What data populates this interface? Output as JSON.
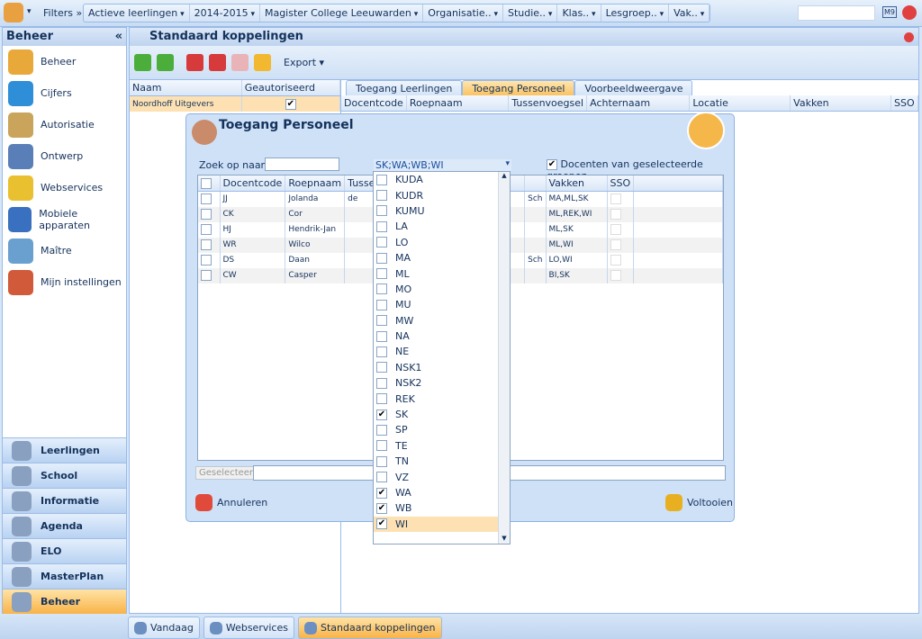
{
  "topbar": {
    "filters_label": "Filters »",
    "filters": [
      "Actieve leerlingen",
      "2014-2015",
      "Magister College Leeuwarden",
      "Organisatie..",
      "Studie..",
      "Klas..",
      "Lesgroep..",
      "Vak.."
    ],
    "search_placeholder": "",
    "m9": "M9"
  },
  "sidebar": {
    "title": "Beheer",
    "collapse": "«",
    "items": [
      "Beheer",
      "Cijfers",
      "Autorisatie",
      "Ontwerp",
      "Webservices",
      "Mobiele apparaten",
      "Maître",
      "Mijn instellingen"
    ],
    "nav": [
      "Leerlingen",
      "School",
      "Informatie",
      "Agenda",
      "ELO",
      "MasterPlan",
      "Beheer"
    ],
    "nav_active": "Beheer"
  },
  "main": {
    "title": "Standaard koppelingen",
    "export_label": "Export",
    "left_table": {
      "headers": [
        "Naam",
        "Geautoriseerd"
      ],
      "rows": [
        {
          "naam": "Noordhoff Uitgevers",
          "geautoriseerd": true
        }
      ]
    },
    "tabs": [
      "Toegang Leerlingen",
      "Toegang Personeel",
      "Voorbeeldweergave"
    ],
    "active_tab": "Toegang Personeel",
    "right_headers": [
      "Docentcode",
      "Roepnaam",
      "Tussenvoegsel",
      "Achternaam",
      "Locatie",
      "Vakken",
      "SSO"
    ]
  },
  "dialog": {
    "title": "Toegang Personeel",
    "search_label": "Zoek op naam",
    "search_value": "",
    "vak_select": "SK;WA;WB;WI",
    "groups_checkbox_label": "Docenten van geselecteerde groepen",
    "groups_checked": true,
    "headers": [
      "Docentcode",
      "Roepnaam",
      "Tussenvo",
      "Vakken",
      "SSO"
    ],
    "rows": [
      {
        "code": "JJ",
        "roepnaam": "Jolanda",
        "tussen": "de",
        "locatie": "Sch",
        "vakken": "MA,ML,SK"
      },
      {
        "code": "CK",
        "roepnaam": "Cor",
        "tussen": "",
        "locatie": "",
        "vakken": "ML,REK,WI"
      },
      {
        "code": "HJ",
        "roepnaam": "Hendrik-Jan",
        "tussen": "",
        "locatie": "",
        "vakken": "ML,SK"
      },
      {
        "code": "WR",
        "roepnaam": "Wilco",
        "tussen": "",
        "locatie": "",
        "vakken": "ML,WI"
      },
      {
        "code": "DS",
        "roepnaam": "Daan",
        "tussen": "",
        "locatie": "Sch",
        "vakken": "LO,WI"
      },
      {
        "code": "CW",
        "roepnaam": "Casper",
        "tussen": "",
        "locatie": "",
        "vakken": "BI,SK"
      }
    ],
    "selected_button": "Geselecteerd",
    "cancel": "Annuleren",
    "finish": "Voltooien",
    "options": [
      {
        "v": "KUDA"
      },
      {
        "v": "KUDR"
      },
      {
        "v": "KUMU"
      },
      {
        "v": "LA"
      },
      {
        "v": "LO"
      },
      {
        "v": "MA"
      },
      {
        "v": "ML"
      },
      {
        "v": "MO"
      },
      {
        "v": "MU"
      },
      {
        "v": "MW"
      },
      {
        "v": "NA"
      },
      {
        "v": "NE"
      },
      {
        "v": "NSK1"
      },
      {
        "v": "NSK2"
      },
      {
        "v": "REK"
      },
      {
        "v": "SK",
        "c": true
      },
      {
        "v": "SP"
      },
      {
        "v": "TE"
      },
      {
        "v": "TN"
      },
      {
        "v": "VZ"
      },
      {
        "v": "WA",
        "c": true
      },
      {
        "v": "WB",
        "c": true
      },
      {
        "v": "WI",
        "c": true,
        "hl": true
      }
    ]
  },
  "taskbar": [
    "Vandaag",
    "Webservices",
    "Standaard koppelingen"
  ],
  "taskbar_active": "Standaard koppelingen",
  "colors": {
    "accent": "#f9b347",
    "header": "#bfd4ef",
    "border": "#99bbe8"
  }
}
